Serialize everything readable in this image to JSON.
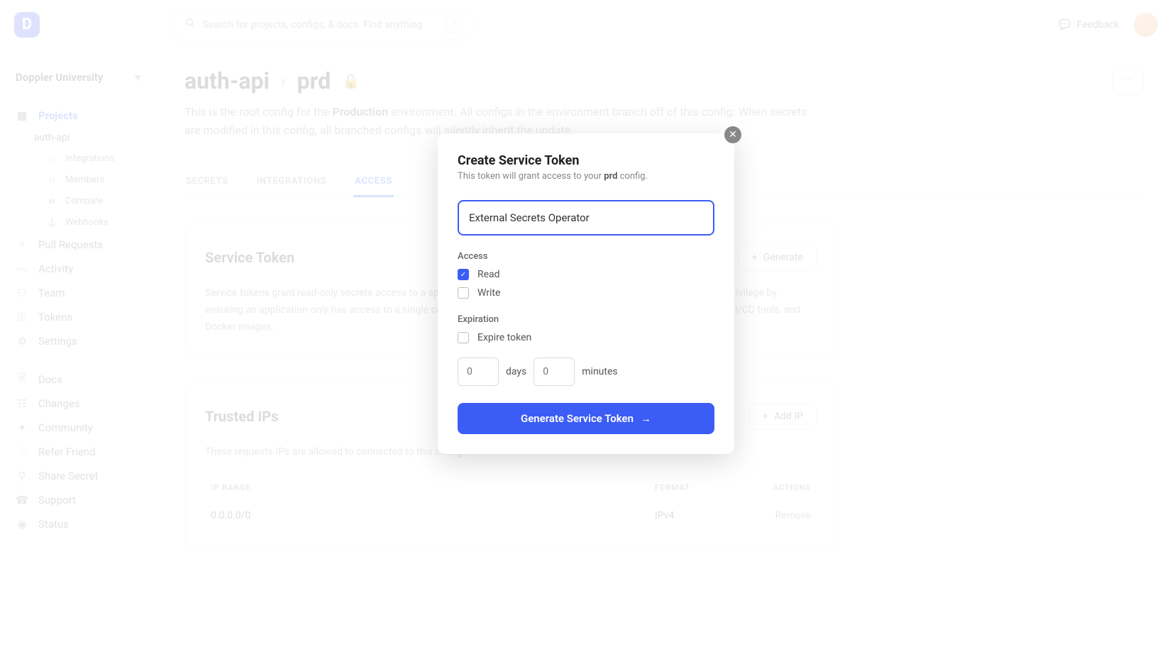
{
  "header": {
    "search_placeholder": "Search for projects, configs, & docs. Find anything.",
    "search_shortcut": "/",
    "feedback_label": "Feedback"
  },
  "sidebar": {
    "workspace": "Doppler University",
    "primary": [
      {
        "icon": "folder",
        "label": "Projects",
        "active": true
      }
    ],
    "project_name": "auth-api",
    "sub_items": [
      {
        "icon": "integrations",
        "label": "Integrations"
      },
      {
        "icon": "members",
        "label": "Members"
      },
      {
        "icon": "compare",
        "label": "Compare"
      },
      {
        "icon": "webhooks",
        "label": "Webhooks"
      }
    ],
    "nav": [
      {
        "icon": "pr",
        "label": "Pull Requests"
      },
      {
        "icon": "activity",
        "label": "Activity"
      },
      {
        "icon": "team",
        "label": "Team"
      },
      {
        "icon": "tokens",
        "label": "Tokens"
      },
      {
        "icon": "settings",
        "label": "Settings"
      }
    ],
    "nav2": [
      {
        "icon": "docs",
        "label": "Docs"
      },
      {
        "icon": "changes",
        "label": "Changes"
      },
      {
        "icon": "community",
        "label": "Community"
      },
      {
        "icon": "refer",
        "label": "Refer Friend"
      },
      {
        "icon": "share",
        "label": "Share Secret"
      },
      {
        "icon": "support",
        "label": "Support"
      },
      {
        "icon": "status",
        "label": "Status"
      }
    ]
  },
  "breadcrumb": {
    "project": "auth-api",
    "config": "prd"
  },
  "page_desc": {
    "prefix": "This is the root config for the ",
    "env": "Production",
    "rest": " environment. All configs in the environment branch off of this config. When secrets are modified in this config, all branched configs will silently inherit the update."
  },
  "tabs": [
    {
      "label": "SECRETS",
      "active": false
    },
    {
      "label": "INTEGRATIONS",
      "active": false
    },
    {
      "label": "ACCESS",
      "active": true
    }
  ],
  "sections": {
    "service_token": {
      "title": "Service Token",
      "button": "Generate",
      "text": "Service tokens grant read-only secrets access to a specific config within a project. They adhere to the principle of least privilege by ensuring an application only has access to a single config within a project. They are typically used by your applications, CI/CD tools, and Docker images."
    },
    "trusted_ips": {
      "title": "Trusted IPs",
      "button": "Add IP",
      "text": "These requests IPs are allowed to connected to this config.",
      "columns": [
        "IP RANGE",
        "FORMAT",
        "ACTIONS"
      ],
      "rows": [
        {
          "ip": "0.0.0.0/0",
          "format": "IPv4",
          "action": "Remove"
        }
      ]
    }
  },
  "modal": {
    "title": "Create Service Token",
    "subtitle_prefix": "This token will grant access to your ",
    "subtitle_config": "prd",
    "subtitle_suffix": " config.",
    "name_value": "External Secrets Operator",
    "access_label": "Access",
    "read_label": "Read",
    "write_label": "Write",
    "expiration_label": "Expiration",
    "expire_token_label": "Expire token",
    "days_placeholder": "0",
    "days_label": "days",
    "minutes_placeholder": "0",
    "minutes_label": "minutes",
    "submit_label": "Generate Service Token"
  }
}
